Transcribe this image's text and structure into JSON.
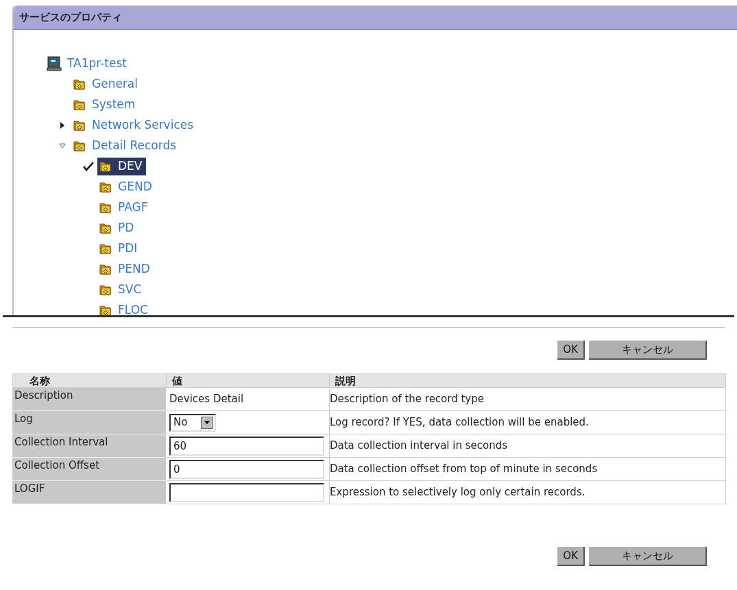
{
  "panel": {
    "title": "サービスのプロパティ"
  },
  "tree": [
    {
      "label": "TA1pr-test",
      "kind": "computer",
      "selected": false,
      "children": [
        {
          "label": "General",
          "kind": "folder",
          "selected": false
        },
        {
          "label": "System",
          "kind": "folder",
          "selected": false
        },
        {
          "label": "Network Services",
          "kind": "folder",
          "selected": false,
          "expanded": false
        },
        {
          "label": "Detail Records",
          "kind": "folder",
          "selected": false,
          "expanded": true,
          "children": [
            {
              "label": "DEV",
              "kind": "folder",
              "selected": true
            },
            {
              "label": "GEND",
              "kind": "folder",
              "selected": false
            },
            {
              "label": "PAGF",
              "kind": "folder",
              "selected": false
            },
            {
              "label": "PD",
              "kind": "folder",
              "selected": false
            },
            {
              "label": "PDI",
              "kind": "folder",
              "selected": false
            },
            {
              "label": "PEND",
              "kind": "folder",
              "selected": false
            },
            {
              "label": "SVC",
              "kind": "folder",
              "selected": false
            },
            {
              "label": "FLOC",
              "kind": "folder",
              "selected": false
            }
          ]
        }
      ]
    }
  ],
  "top_buttons": [
    "OK",
    "キャンセル"
  ],
  "table": {
    "columns": [
      "名称",
      "値",
      "説明"
    ],
    "rows": [
      {
        "name": "Description",
        "kind": "text",
        "value": "Devices Detail",
        "description": "Description of the record type"
      },
      {
        "name": "Log",
        "kind": "select",
        "value": "No",
        "description": "Log record? If YES, data collection will be enabled."
      },
      {
        "name": "Collection Interval",
        "kind": "input",
        "value": "60",
        "description": "Data collection interval in seconds"
      },
      {
        "name": "Collection Offset",
        "kind": "input",
        "value": "0",
        "description": "Data collection offset from top of minute in seconds"
      },
      {
        "name": "LOGIF",
        "kind": "input",
        "value": "",
        "description": "Expression to selectively log only certain records."
      }
    ]
  },
  "bottom_buttons": [
    "OK",
    "キャンセル"
  ]
}
